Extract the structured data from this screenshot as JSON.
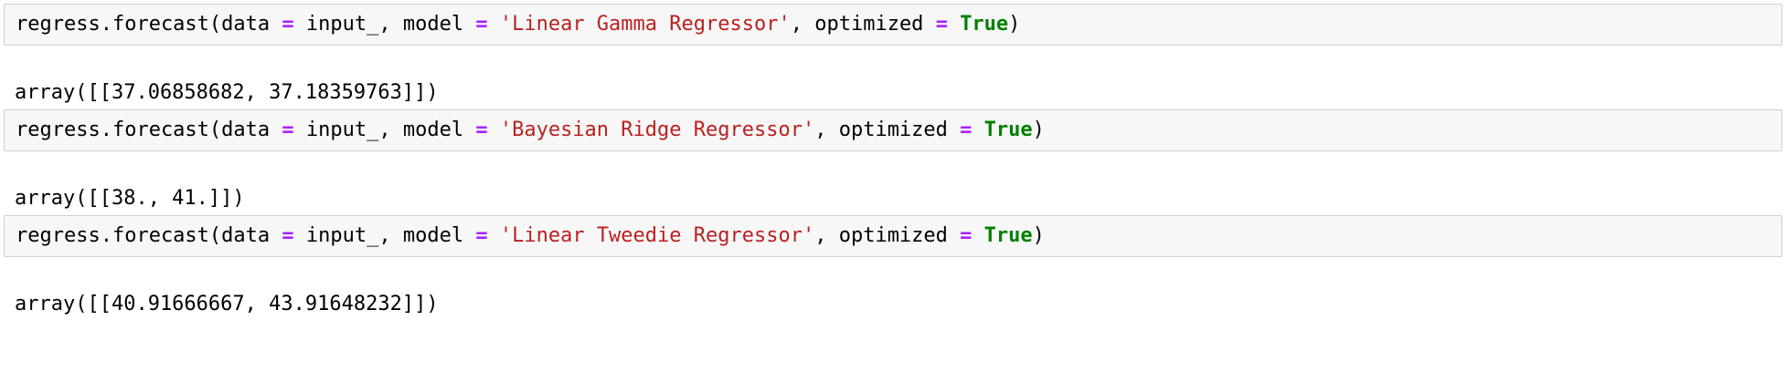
{
  "cells": [
    {
      "input": {
        "fn": "regress.forecast(data ",
        "eq1": "=",
        "arg1": " input_, model ",
        "eq2": "=",
        "sp": " ",
        "model_str": "'Linear Gamma Regressor'",
        "arg2": ", optimized ",
        "eq3": "=",
        "sp2": " ",
        "kw": "True",
        "close": ")"
      },
      "output": "array([[37.06858682, 37.18359763]])"
    },
    {
      "input": {
        "fn": "regress.forecast(data ",
        "eq1": "=",
        "arg1": " input_, model ",
        "eq2": "=",
        "sp": " ",
        "model_str": "'Bayesian Ridge Regressor'",
        "arg2": ", optimized ",
        "eq3": "=",
        "sp2": " ",
        "kw": "True",
        "close": ")"
      },
      "output": "array([[38., 41.]])"
    },
    {
      "input": {
        "fn": "regress.forecast(data ",
        "eq1": "=",
        "arg1": " input_, model ",
        "eq2": "=",
        "sp": " ",
        "model_str": "'Linear Tweedie Regressor'",
        "arg2": ", optimized ",
        "eq3": "=",
        "sp2": " ",
        "kw": "True",
        "close": ")"
      },
      "output": "array([[40.91666667, 43.91648232]])"
    }
  ]
}
